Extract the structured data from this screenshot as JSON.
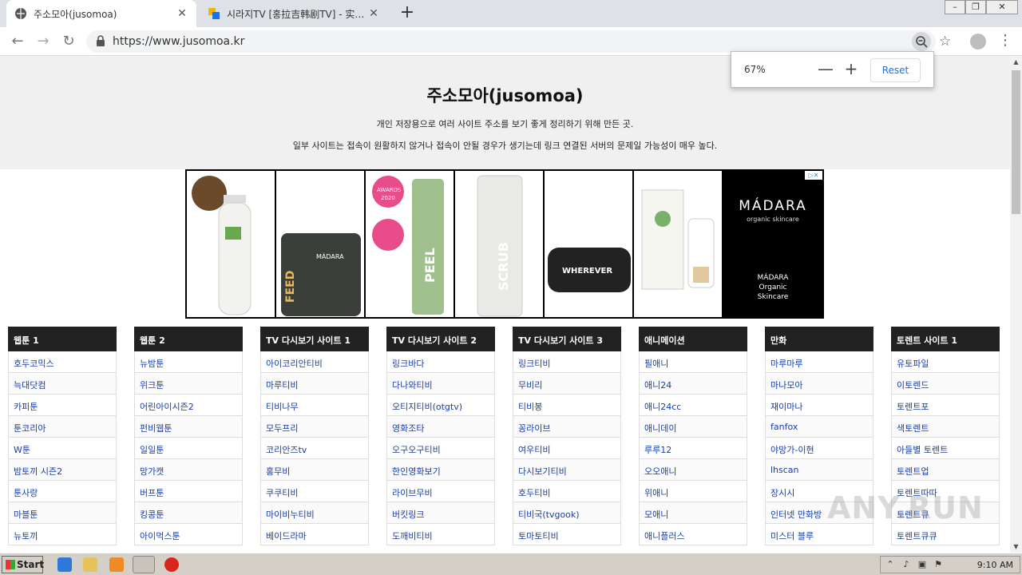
{
  "browser": {
    "tabs": [
      {
        "title": "주소모아(jusomoa)",
        "active": true
      },
      {
        "title": "시라지TV [홍拉吉韩剧TV] - 实时更新",
        "active": false
      }
    ],
    "new_tab": "+",
    "close_glyph": "✕",
    "url": "https://www.jusomoa.kr"
  },
  "zoom_popup": {
    "level": "67%",
    "minus": "—",
    "plus": "+",
    "reset": "Reset"
  },
  "header": {
    "title": "주소모아(jusomoa)",
    "desc1": "개인 저장용으로 여러 사이트 주소를 보기 좋게 정리하기 위해 만든 곳.",
    "desc2": "일부 사이트는 접속이 원활하지 않거나 접속이 안될 경우가 생기는데 링크 연결된 서버의 문제일 가능성이 매우 높다."
  },
  "ad": {
    "brand_logo": "MÁDARA",
    "brand_sub": "organic skincare",
    "caption_lines": [
      "MÁDARA",
      "Organic",
      "Skincare"
    ],
    "products": [
      "FEED",
      "PEEL",
      "SCRUB",
      "WHEREVER"
    ],
    "badges": [
      "AWARDS",
      "2020"
    ]
  },
  "columns": [
    {
      "header": "웹툰 1",
      "items": [
        "호두코믹스",
        "늑대닷컴",
        "카피툰",
        "툰코리아",
        "W툰",
        "밤토끼 시즌2",
        "툰사랑",
        "마블툰",
        "뉴토끼"
      ]
    },
    {
      "header": "웹툰 2",
      "items": [
        "뉴밤툰",
        "위크툰",
        "어린아이시즌2",
        "펀비웹툰",
        "일일툰",
        "망가캣",
        "버프툰",
        "킹콩툰",
        "아이먹스툰"
      ]
    },
    {
      "header": "TV 다시보기 사이트 1",
      "items": [
        "아이코리안티비",
        "마루티비",
        "티비나무",
        "모두프리",
        "코리안즈tv",
        "홍무비",
        "쿠쿠티비",
        "마이비누티비",
        "베이드라마"
      ]
    },
    {
      "header": "TV 다시보기 사이트 2",
      "items": [
        "링크바다",
        "다나와티비",
        "오티지티비(otgtv)",
        "영화조타",
        "오구오구티비",
        "한인영화보기",
        "라이브무비",
        "버킷링크",
        "도깨비티비"
      ]
    },
    {
      "header": "TV 다시보기 사이트 3",
      "items": [
        "링크티비",
        "무비리",
        "티비봉",
        "꽁라이브",
        "여우티비",
        "다시보기티비",
        "호두티비",
        "티비국(tvgook)",
        "토마토티비"
      ]
    },
    {
      "header": "애니메이션",
      "items": [
        "필애니",
        "애니24",
        "애니24cc",
        "애니데이",
        "루루12",
        "오오애니",
        "위애니",
        "모애니",
        "애니플러스"
      ]
    },
    {
      "header": "만화",
      "items": [
        "마루마루",
        "마나모아",
        "재이마나",
        "fanfox",
        "야망가-이현",
        "lhscan",
        "장시시",
        "인터넷 만화방",
        "미스터 블루"
      ]
    },
    {
      "header": "토렌트 사이트 1",
      "items": [
        "유토파일",
        "이토렌드",
        "토렌트포",
        "색토렌트",
        "아들별 토렌트",
        "토렌트업",
        "토렌트따따",
        "토렌트큐",
        "토렌트큐큐"
      ]
    }
  ],
  "taskbar": {
    "start": "Start",
    "clock": "9:10 AM"
  },
  "watermark": "ANY.RUN"
}
